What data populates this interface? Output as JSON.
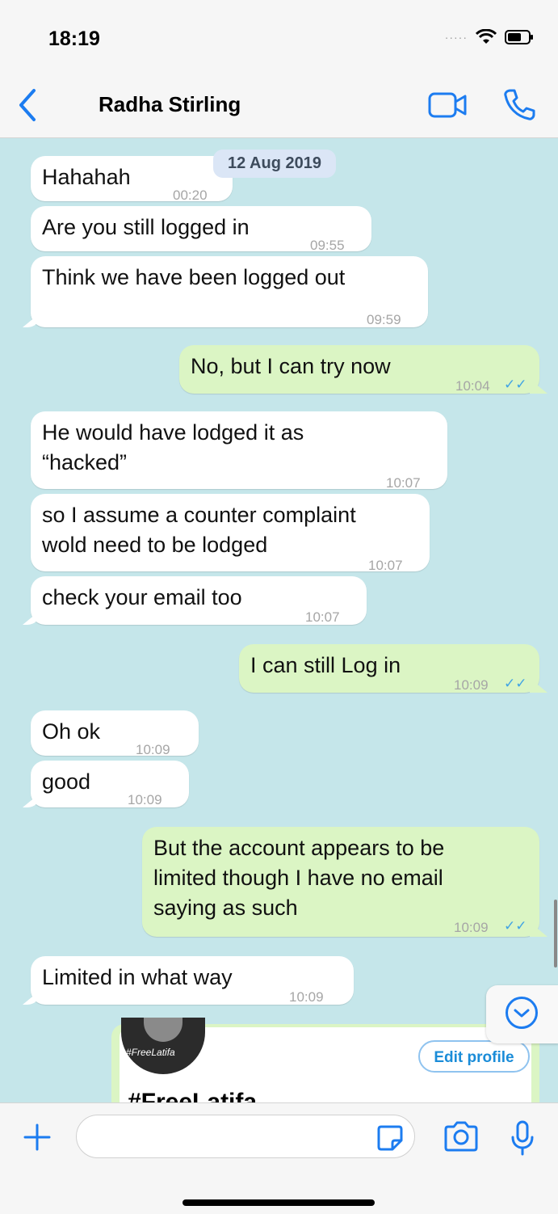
{
  "status": {
    "time": "18:19"
  },
  "header": {
    "contact_name": "Radha Stirling"
  },
  "chat": {
    "date_label": "12 Aug 2019",
    "messages": [
      {
        "dir": "in",
        "text": "Hahahah",
        "time": "00:20"
      },
      {
        "dir": "in",
        "text": "Are you still logged in",
        "time": "09:55"
      },
      {
        "dir": "in",
        "text": "Think we have been logged out",
        "time": "09:59"
      },
      {
        "dir": "out",
        "text": "No, but I can try now",
        "time": "10:04",
        "ticks": "✓✓"
      },
      {
        "dir": "in",
        "text": "He would have lodged it as\n“hacked”",
        "time": "10:07"
      },
      {
        "dir": "in",
        "text": "so I assume a counter complaint\nwold need to be lodged",
        "time": "10:07"
      },
      {
        "dir": "in",
        "text": "check your email too",
        "time": "10:07"
      },
      {
        "dir": "out",
        "text": "I can still Log in",
        "time": "10:09",
        "ticks": "✓✓"
      },
      {
        "dir": "in",
        "text": "Oh ok",
        "time": "10:09"
      },
      {
        "dir": "in",
        "text": "good",
        "time": "10:09"
      },
      {
        "dir": "out",
        "text": "But the account appears to be\nlimited though I have no email\nsaying as such",
        "time": "10:09",
        "ticks": "✓✓"
      },
      {
        "dir": "in",
        "text": "Limited in what way",
        "time": "10:09"
      }
    ],
    "preview": {
      "avatar_tag": "#FreeLatifa",
      "edit_profile_label": "Edit profile",
      "title": "#FreeLatifa"
    }
  },
  "composer": {
    "placeholder": ""
  },
  "colors": {
    "accent": "#1c7cf0",
    "outgoing": "#dbf5c4",
    "chat_bg": "#c5e6ea"
  },
  "icons": [
    "back-chevron-icon",
    "video-call-icon",
    "phone-icon",
    "plus-icon",
    "sticker-icon",
    "camera-icon",
    "microphone-icon",
    "scroll-down-icon",
    "wifi-icon",
    "battery-icon"
  ]
}
